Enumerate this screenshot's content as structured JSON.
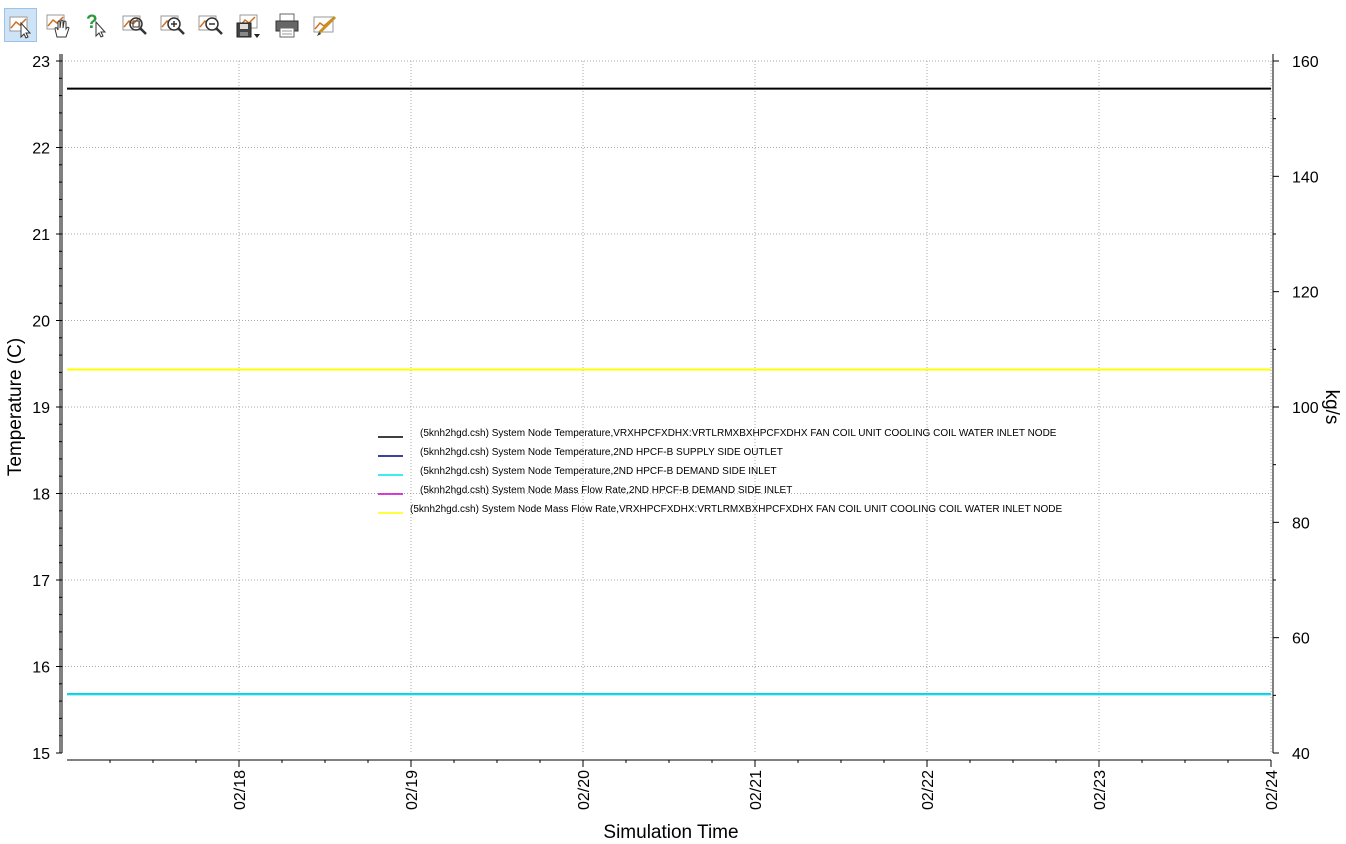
{
  "toolbar": {
    "buttons": [
      {
        "name": "select-pointer",
        "icon": "pointer-chart-icon",
        "active": true
      },
      {
        "name": "pan",
        "icon": "hand-chart-icon",
        "active": false
      },
      {
        "name": "what-is-this",
        "icon": "help-pointer-icon",
        "active": false
      },
      {
        "name": "zoom-window",
        "icon": "zoom-window-icon",
        "active": false
      },
      {
        "name": "zoom-in",
        "icon": "zoom-in-icon",
        "active": false
      },
      {
        "name": "zoom-out",
        "icon": "zoom-out-icon",
        "active": false
      },
      {
        "name": "save",
        "icon": "save-dropdown-icon",
        "active": false
      },
      {
        "name": "print",
        "icon": "print-icon",
        "active": false
      },
      {
        "name": "edit-chart",
        "icon": "edit-chart-icon",
        "active": false
      }
    ]
  },
  "chart_data": {
    "type": "line",
    "xlabel": "Simulation Time",
    "ylabel": "Temperature (C)",
    "y2label": "kg/s",
    "xlim": [
      "02/17 00:00",
      "02/24 00:00"
    ],
    "x_ticks": [
      "02/18",
      "02/19",
      "02/20",
      "02/21",
      "02/22",
      "02/23",
      "02/24"
    ],
    "ylim": [
      15,
      23
    ],
    "y_ticks": [
      15,
      16,
      17,
      18,
      19,
      20,
      21,
      22,
      23
    ],
    "y2lim": [
      40,
      160
    ],
    "y2_ticks": [
      40,
      60,
      80,
      100,
      120,
      140,
      160
    ],
    "grid": true,
    "legend_position": "center",
    "series": [
      {
        "name": "(5knh2hgd.csh) System Node Temperature,VRXHPCFXDHX:VRTLRMXBXHPCFXDHX FAN COIL UNIT COOLING COIL WATER INLET NODE",
        "color": "#000000",
        "axis": "left",
        "x": [
          "02/17 00:00",
          "02/24 00:00"
        ],
        "values": [
          22.68,
          22.68
        ]
      },
      {
        "name": "(5knh2hgd.csh) System Node Temperature,2ND HPCF-B SUPPLY SIDE OUTLET",
        "color": "#000080",
        "axis": "left",
        "x": [
          "02/17 00:00",
          "02/24 00:00"
        ],
        "values": [
          15.68,
          15.68
        ]
      },
      {
        "name": "(5knh2hgd.csh) System Node Temperature,2ND HPCF-B DEMAND SIDE INLET",
        "color": "#00e5ee",
        "axis": "left",
        "x": [
          "02/17 00:00",
          "02/24 00:00"
        ],
        "values": [
          15.68,
          15.68
        ]
      },
      {
        "name": "(5knh2hgd.csh) System Node Mass Flow Rate,2ND HPCF-B DEMAND SIDE INLET",
        "color": "#cc00cc",
        "axis": "right",
        "x": [
          "02/17 00:00",
          "02/24 00:00"
        ],
        "values": [
          106.5,
          106.5
        ]
      },
      {
        "name": "(5knh2hgd.csh) System Node Mass Flow Rate,VRXHPCFXDHX:VRTLRMXBXHPCFXDHX FAN COIL UNIT COOLING COIL WATER INLET NODE",
        "color": "#ffff00",
        "axis": "right",
        "x": [
          "02/17 00:00",
          "02/24 00:00"
        ],
        "values": [
          106.5,
          106.5
        ]
      }
    ]
  }
}
